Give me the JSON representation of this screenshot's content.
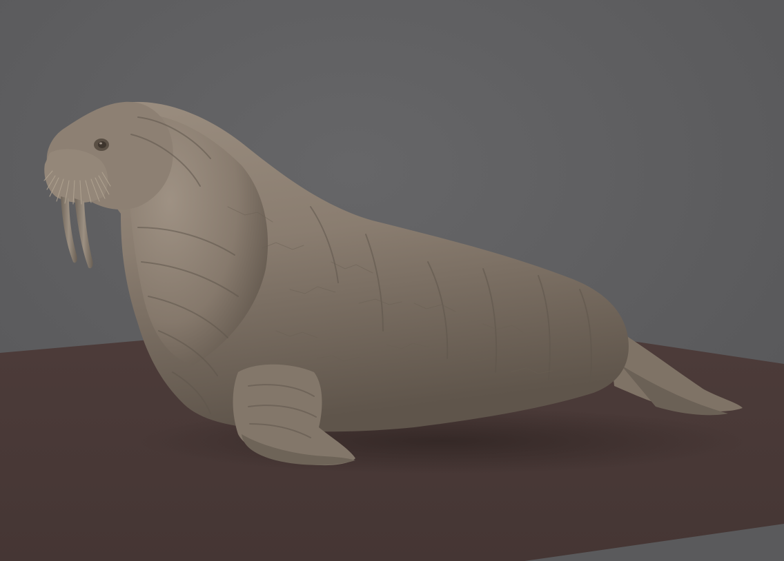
{
  "scene": {
    "subject": "walrus-sculpt",
    "colors": {
      "background": "#5a5a5c",
      "background_light": "#626264",
      "floor": "#4a3a38",
      "floor_dark": "#3f312f",
      "skin_base": "#8a7d70",
      "skin_light": "#a09385",
      "skin_shadow": "#5e544a",
      "tusk": "#8b7f72",
      "whisker": "#b8ab98",
      "eye": "#4b4138"
    }
  }
}
